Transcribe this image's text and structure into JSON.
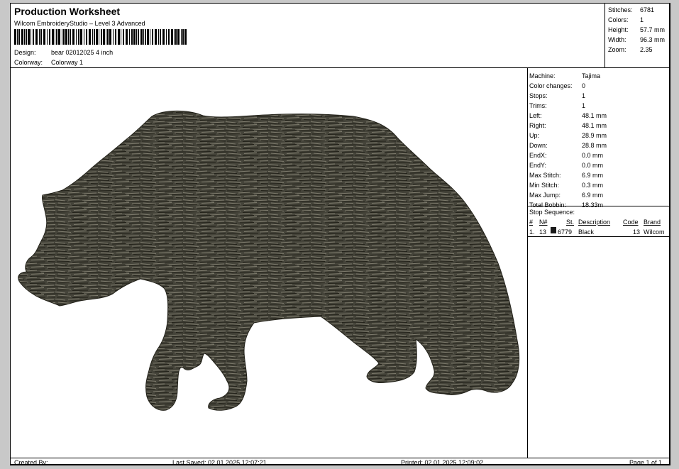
{
  "header": {
    "title": "Production Worksheet",
    "software": "Wilcom EmbroideryStudio – Level 3 Advanced",
    "design_label": "Design:",
    "design_value": "bear 02012025 4 inch",
    "colorway_label": "Colorway:",
    "colorway_value": "Colorway 1"
  },
  "stats": [
    {
      "label": "Stitches:",
      "value": "6781"
    },
    {
      "label": "Colors:",
      "value": "1"
    },
    {
      "label": "Height:",
      "value": "57.7 mm"
    },
    {
      "label": "Width:",
      "value": "96.3 mm"
    },
    {
      "label": "Zoom:",
      "value": "2.35"
    }
  ],
  "machine_info": [
    {
      "label": "Machine:",
      "value": "Tajima"
    },
    {
      "label": "Color changes:",
      "value": "0"
    },
    {
      "label": "Stops:",
      "value": "1"
    },
    {
      "label": "Trims:",
      "value": "1"
    },
    {
      "label": "Left:",
      "value": "48.1 mm"
    },
    {
      "label": "Right:",
      "value": "48.1 mm"
    },
    {
      "label": "Up:",
      "value": "28.9 mm"
    },
    {
      "label": "Down:",
      "value": "28.8 mm"
    },
    {
      "label": "EndX:",
      "value": "0.0 mm"
    },
    {
      "label": "EndY:",
      "value": "0.0 mm"
    },
    {
      "label": "Max Stitch:",
      "value": "6.9 mm"
    },
    {
      "label": "Min Stitch:",
      "value": "0.3 mm"
    },
    {
      "label": "Max Jump:",
      "value": "6.9 mm"
    },
    {
      "label": "Total Bobbin:",
      "value": "18.33m"
    }
  ],
  "stop_sequence": {
    "title": "Stop Sequence:",
    "headers": {
      "num": "#",
      "n": "N#",
      "st": "St.",
      "description": "Description",
      "code": "Code",
      "brand": "Brand"
    },
    "rows": [
      {
        "num": "1.",
        "n": "13",
        "color": "#1a1a1a",
        "st": "6779",
        "description": "Black",
        "code": "13",
        "brand": "Wilcom"
      }
    ]
  },
  "footer": {
    "created_by": "Created By:",
    "last_saved": "Last Saved: 02.01.2025 12:07:21",
    "printed": "Printed: 02.01.2025 12:09:02",
    "page": "Page 1 of 1"
  },
  "design": {
    "thread_color": "#45443a",
    "stitch_highlight": "#7d7a6c",
    "stitch_shadow": "#222119"
  }
}
